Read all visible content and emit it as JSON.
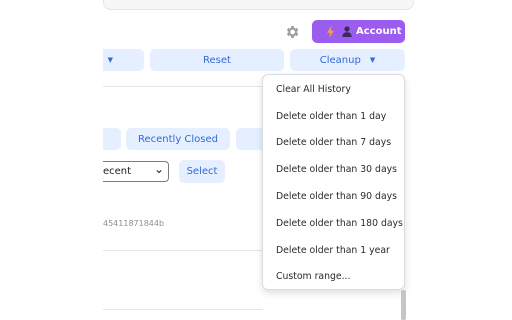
{
  "header": {
    "account_label": "Account"
  },
  "toolbar": {
    "reset_label": "Reset",
    "cleanup_label": "Cleanup",
    "dropdown_arrow": "▼"
  },
  "filters": {
    "recently_closed_label": "Recently Closed",
    "sort_value": "ecent",
    "sort_arrow": "⌄",
    "select_label": "Select"
  },
  "entry": {
    "id_fragment": "45411871844b"
  },
  "cleanup_menu": {
    "items": [
      "Clear All History",
      "Delete older than 1 day",
      "Delete older than 7 days",
      "Delete older than 30 days",
      "Delete older than 90 days",
      "Delete older than 180 days",
      "Delete older than 1 year",
      "Custom range..."
    ]
  },
  "colors": {
    "account_bg": "#9b5cf0",
    "button_bg": "#e6efff",
    "button_text": "#2f6ad6",
    "flash_icon": "#f5a04a"
  },
  "icons": [
    "gear-icon",
    "lightning-icon",
    "person-icon",
    "chevron-down-icon"
  ]
}
